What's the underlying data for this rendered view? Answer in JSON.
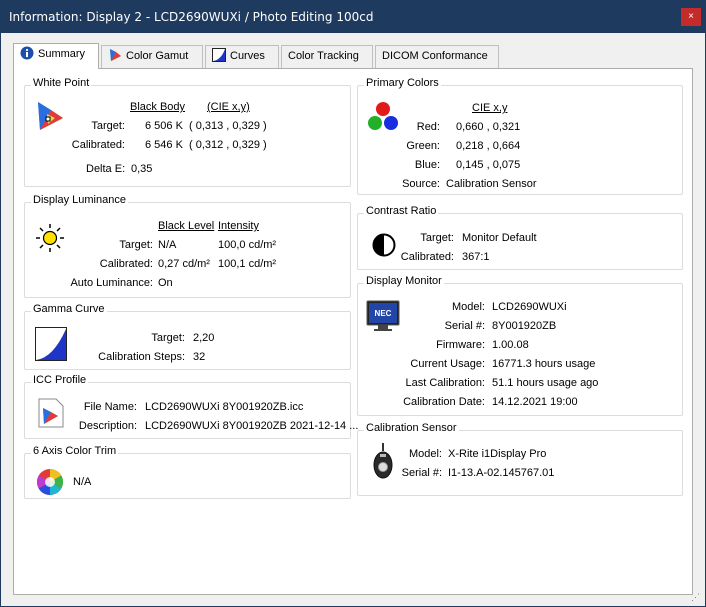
{
  "window": {
    "title": "Information: Display 2 - LCD2690WUXi / Photo Editing 100cd",
    "close_glyph": "×"
  },
  "tabs": [
    {
      "label": "Summary",
      "icon": "info-icon"
    },
    {
      "label": "Color Gamut",
      "icon": "color-gamut-icon"
    },
    {
      "label": "Curves",
      "icon": "curves-icon"
    },
    {
      "label": "Color Tracking"
    },
    {
      "label": "DICOM Conformance"
    }
  ],
  "white_point": {
    "title": "White Point",
    "col_black_body": "Black Body",
    "col_cie": "(CIE x,y)",
    "target_label": "Target:",
    "target_temp": "6 506 K",
    "target_cie": "( 0,313 , 0,329 )",
    "calibrated_label": "Calibrated:",
    "calibrated_temp": "6 546 K",
    "calibrated_cie": "( 0,312 , 0,329 )",
    "delta_label": "Delta E:",
    "delta_value": "0,35"
  },
  "luminance": {
    "title": "Display Luminance",
    "col_black": "Black Level",
    "col_intensity": "Intensity",
    "target_label": "Target:",
    "target_black": "N/A",
    "target_intensity": "100,0 cd/m²",
    "calibrated_label": "Calibrated:",
    "calibrated_black": "0,27 cd/m²",
    "calibrated_intensity": "100,1 cd/m²",
    "auto_label": "Auto Luminance:",
    "auto_value": "On"
  },
  "gamma": {
    "title": "Gamma Curve",
    "target_label": "Target:",
    "target_value": "2,20",
    "steps_label": "Calibration Steps:",
    "steps_value": "32"
  },
  "icc": {
    "title": "ICC Profile",
    "file_label": "File Name:",
    "file_value": "LCD2690WUXi 8Y001920ZB.icc",
    "desc_label": "Description:",
    "desc_value": "LCD2690WUXi 8Y001920ZB 2021-12-14 ..."
  },
  "color_trim": {
    "title": "6 Axis Color Trim",
    "value": "N/A"
  },
  "primaries": {
    "title": "Primary Colors",
    "col_cie": "CIE x,y",
    "red_label": "Red:",
    "red_value": "0,660 , 0,321",
    "green_label": "Green:",
    "green_value": "0,218 , 0,664",
    "blue_label": "Blue:",
    "blue_value": "0,145 , 0,075",
    "source_label": "Source:",
    "source_value": "Calibration Sensor"
  },
  "contrast": {
    "title": "Contrast Ratio",
    "target_label": "Target:",
    "target_value": "Monitor Default",
    "calibrated_label": "Calibrated:",
    "calibrated_value": "367:1"
  },
  "monitor": {
    "title": "Display Monitor",
    "logo_text": "NEC",
    "model_label": "Model:",
    "model_value": "LCD2690WUXi",
    "serial_label": "Serial #:",
    "serial_value": "8Y001920ZB",
    "firmware_label": "Firmware:",
    "firmware_value": "1.00.08",
    "usage_label": "Current Usage:",
    "usage_value": "16771.3 hours usage",
    "lastcal_label": "Last Calibration:",
    "lastcal_value": "51.1 hours usage ago",
    "caldate_label": "Calibration Date:",
    "caldate_value": "14.12.2021 19:00"
  },
  "sensor": {
    "title": "Calibration Sensor",
    "model_label": "Model:",
    "model_value": "X-Rite i1Display Pro",
    "serial_label": "Serial #:",
    "serial_value": "I1-13.A-02.145767.01"
  },
  "colors": {
    "titlebar": "#1f3a5f",
    "close_button": "#c42b2b",
    "gamma_fill": "#1f35c8"
  }
}
